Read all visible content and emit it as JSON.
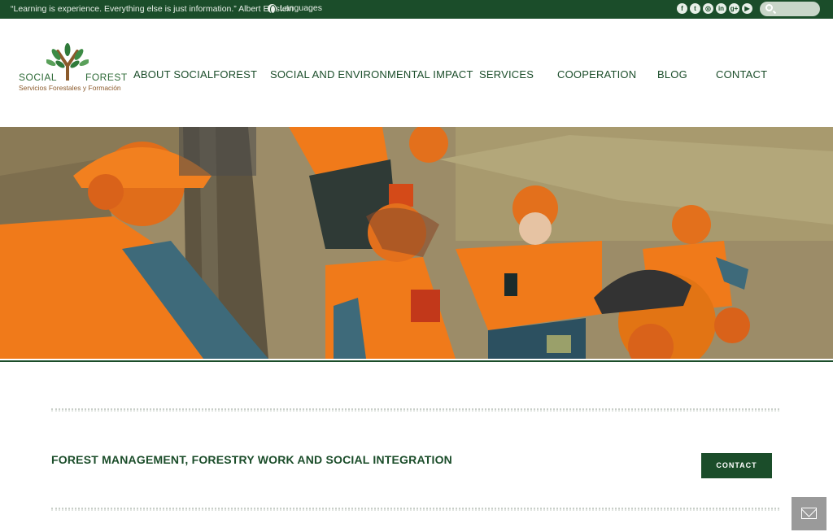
{
  "topbar": {
    "quote": "“Learning is experience. Everything else is just information.” Albert Einstein",
    "languages_label": "Languages",
    "social_icons": [
      "facebook-icon",
      "twitter-icon",
      "instagram-icon",
      "linkedin-icon",
      "googleplus-icon",
      "youtube-icon"
    ],
    "social_glyphs": [
      "f",
      "t",
      "◎",
      "in",
      "g+",
      "▶"
    ]
  },
  "logo": {
    "word_left": "SOCIAL",
    "word_right": "FOREST",
    "subtitle": "Servicios Forestales y Formación"
  },
  "nav": {
    "items": [
      {
        "label": "ABOUT SOCIALFOREST"
      },
      {
        "label": "SOCIAL AND ENVIRONMENTAL IMPACT"
      },
      {
        "label": "SERVICES"
      },
      {
        "label": "COOPERATION"
      },
      {
        "label": "BLOG"
      },
      {
        "label": "CONTACT"
      }
    ]
  },
  "main": {
    "tagline": "FOREST MANAGEMENT, FORESTRY WORK AND SOCIAL INTEGRATION",
    "cta_label": "CONTACT"
  },
  "colors": {
    "brand_green": "#1b4d2a",
    "hi_vis_orange": "#f07a1a",
    "logo_brown": "#8b5a2b"
  }
}
